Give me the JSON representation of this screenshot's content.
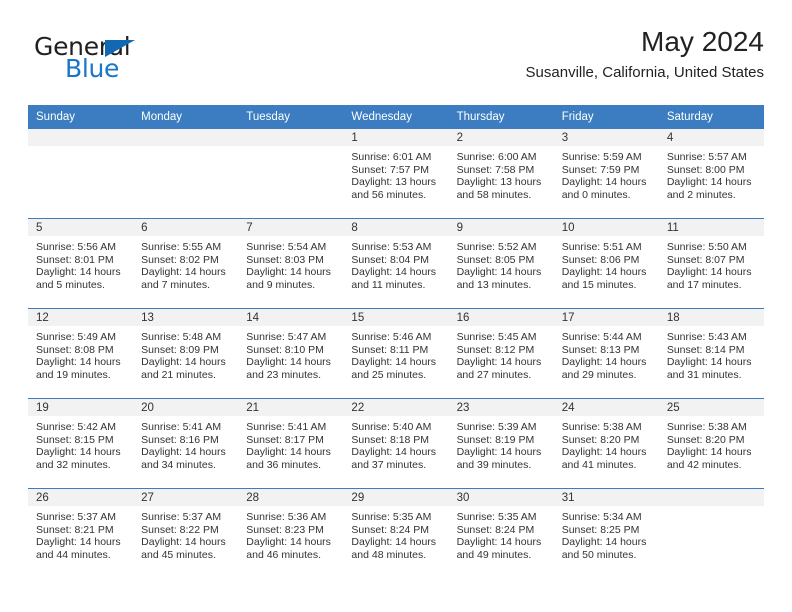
{
  "brand": {
    "name_top": "General",
    "name_bottom": "Blue",
    "accent_color": "#1a76c6",
    "triangle_color": "#1368b4"
  },
  "header": {
    "title": "May 2024",
    "location": "Susanville, California, United States"
  },
  "calendar": {
    "header_bg": "#3b7dc0",
    "daynum_bg": "#f2f2f2",
    "weekday_headers": [
      "Sunday",
      "Monday",
      "Tuesday",
      "Wednesday",
      "Thursday",
      "Friday",
      "Saturday"
    ],
    "weeks": [
      [
        {
          "day": "",
          "sunrise": "",
          "sunset": "",
          "daylight_1": "",
          "daylight_2": ""
        },
        {
          "day": "",
          "sunrise": "",
          "sunset": "",
          "daylight_1": "",
          "daylight_2": ""
        },
        {
          "day": "",
          "sunrise": "",
          "sunset": "",
          "daylight_1": "",
          "daylight_2": ""
        },
        {
          "day": "1",
          "sunrise": "Sunrise: 6:01 AM",
          "sunset": "Sunset: 7:57 PM",
          "daylight_1": "Daylight: 13 hours",
          "daylight_2": "and 56 minutes."
        },
        {
          "day": "2",
          "sunrise": "Sunrise: 6:00 AM",
          "sunset": "Sunset: 7:58 PM",
          "daylight_1": "Daylight: 13 hours",
          "daylight_2": "and 58 minutes."
        },
        {
          "day": "3",
          "sunrise": "Sunrise: 5:59 AM",
          "sunset": "Sunset: 7:59 PM",
          "daylight_1": "Daylight: 14 hours",
          "daylight_2": "and 0 minutes."
        },
        {
          "day": "4",
          "sunrise": "Sunrise: 5:57 AM",
          "sunset": "Sunset: 8:00 PM",
          "daylight_1": "Daylight: 14 hours",
          "daylight_2": "and 2 minutes."
        }
      ],
      [
        {
          "day": "5",
          "sunrise": "Sunrise: 5:56 AM",
          "sunset": "Sunset: 8:01 PM",
          "daylight_1": "Daylight: 14 hours",
          "daylight_2": "and 5 minutes."
        },
        {
          "day": "6",
          "sunrise": "Sunrise: 5:55 AM",
          "sunset": "Sunset: 8:02 PM",
          "daylight_1": "Daylight: 14 hours",
          "daylight_2": "and 7 minutes."
        },
        {
          "day": "7",
          "sunrise": "Sunrise: 5:54 AM",
          "sunset": "Sunset: 8:03 PM",
          "daylight_1": "Daylight: 14 hours",
          "daylight_2": "and 9 minutes."
        },
        {
          "day": "8",
          "sunrise": "Sunrise: 5:53 AM",
          "sunset": "Sunset: 8:04 PM",
          "daylight_1": "Daylight: 14 hours",
          "daylight_2": "and 11 minutes."
        },
        {
          "day": "9",
          "sunrise": "Sunrise: 5:52 AM",
          "sunset": "Sunset: 8:05 PM",
          "daylight_1": "Daylight: 14 hours",
          "daylight_2": "and 13 minutes."
        },
        {
          "day": "10",
          "sunrise": "Sunrise: 5:51 AM",
          "sunset": "Sunset: 8:06 PM",
          "daylight_1": "Daylight: 14 hours",
          "daylight_2": "and 15 minutes."
        },
        {
          "day": "11",
          "sunrise": "Sunrise: 5:50 AM",
          "sunset": "Sunset: 8:07 PM",
          "daylight_1": "Daylight: 14 hours",
          "daylight_2": "and 17 minutes."
        }
      ],
      [
        {
          "day": "12",
          "sunrise": "Sunrise: 5:49 AM",
          "sunset": "Sunset: 8:08 PM",
          "daylight_1": "Daylight: 14 hours",
          "daylight_2": "and 19 minutes."
        },
        {
          "day": "13",
          "sunrise": "Sunrise: 5:48 AM",
          "sunset": "Sunset: 8:09 PM",
          "daylight_1": "Daylight: 14 hours",
          "daylight_2": "and 21 minutes."
        },
        {
          "day": "14",
          "sunrise": "Sunrise: 5:47 AM",
          "sunset": "Sunset: 8:10 PM",
          "daylight_1": "Daylight: 14 hours",
          "daylight_2": "and 23 minutes."
        },
        {
          "day": "15",
          "sunrise": "Sunrise: 5:46 AM",
          "sunset": "Sunset: 8:11 PM",
          "daylight_1": "Daylight: 14 hours",
          "daylight_2": "and 25 minutes."
        },
        {
          "day": "16",
          "sunrise": "Sunrise: 5:45 AM",
          "sunset": "Sunset: 8:12 PM",
          "daylight_1": "Daylight: 14 hours",
          "daylight_2": "and 27 minutes."
        },
        {
          "day": "17",
          "sunrise": "Sunrise: 5:44 AM",
          "sunset": "Sunset: 8:13 PM",
          "daylight_1": "Daylight: 14 hours",
          "daylight_2": "and 29 minutes."
        },
        {
          "day": "18",
          "sunrise": "Sunrise: 5:43 AM",
          "sunset": "Sunset: 8:14 PM",
          "daylight_1": "Daylight: 14 hours",
          "daylight_2": "and 31 minutes."
        }
      ],
      [
        {
          "day": "19",
          "sunrise": "Sunrise: 5:42 AM",
          "sunset": "Sunset: 8:15 PM",
          "daylight_1": "Daylight: 14 hours",
          "daylight_2": "and 32 minutes."
        },
        {
          "day": "20",
          "sunrise": "Sunrise: 5:41 AM",
          "sunset": "Sunset: 8:16 PM",
          "daylight_1": "Daylight: 14 hours",
          "daylight_2": "and 34 minutes."
        },
        {
          "day": "21",
          "sunrise": "Sunrise: 5:41 AM",
          "sunset": "Sunset: 8:17 PM",
          "daylight_1": "Daylight: 14 hours",
          "daylight_2": "and 36 minutes."
        },
        {
          "day": "22",
          "sunrise": "Sunrise: 5:40 AM",
          "sunset": "Sunset: 8:18 PM",
          "daylight_1": "Daylight: 14 hours",
          "daylight_2": "and 37 minutes."
        },
        {
          "day": "23",
          "sunrise": "Sunrise: 5:39 AM",
          "sunset": "Sunset: 8:19 PM",
          "daylight_1": "Daylight: 14 hours",
          "daylight_2": "and 39 minutes."
        },
        {
          "day": "24",
          "sunrise": "Sunrise: 5:38 AM",
          "sunset": "Sunset: 8:20 PM",
          "daylight_1": "Daylight: 14 hours",
          "daylight_2": "and 41 minutes."
        },
        {
          "day": "25",
          "sunrise": "Sunrise: 5:38 AM",
          "sunset": "Sunset: 8:20 PM",
          "daylight_1": "Daylight: 14 hours",
          "daylight_2": "and 42 minutes."
        }
      ],
      [
        {
          "day": "26",
          "sunrise": "Sunrise: 5:37 AM",
          "sunset": "Sunset: 8:21 PM",
          "daylight_1": "Daylight: 14 hours",
          "daylight_2": "and 44 minutes."
        },
        {
          "day": "27",
          "sunrise": "Sunrise: 5:37 AM",
          "sunset": "Sunset: 8:22 PM",
          "daylight_1": "Daylight: 14 hours",
          "daylight_2": "and 45 minutes."
        },
        {
          "day": "28",
          "sunrise": "Sunrise: 5:36 AM",
          "sunset": "Sunset: 8:23 PM",
          "daylight_1": "Daylight: 14 hours",
          "daylight_2": "and 46 minutes."
        },
        {
          "day": "29",
          "sunrise": "Sunrise: 5:35 AM",
          "sunset": "Sunset: 8:24 PM",
          "daylight_1": "Daylight: 14 hours",
          "daylight_2": "and 48 minutes."
        },
        {
          "day": "30",
          "sunrise": "Sunrise: 5:35 AM",
          "sunset": "Sunset: 8:24 PM",
          "daylight_1": "Daylight: 14 hours",
          "daylight_2": "and 49 minutes."
        },
        {
          "day": "31",
          "sunrise": "Sunrise: 5:34 AM",
          "sunset": "Sunset: 8:25 PM",
          "daylight_1": "Daylight: 14 hours",
          "daylight_2": "and 50 minutes."
        },
        {
          "day": "",
          "sunrise": "",
          "sunset": "",
          "daylight_1": "",
          "daylight_2": ""
        }
      ]
    ]
  }
}
